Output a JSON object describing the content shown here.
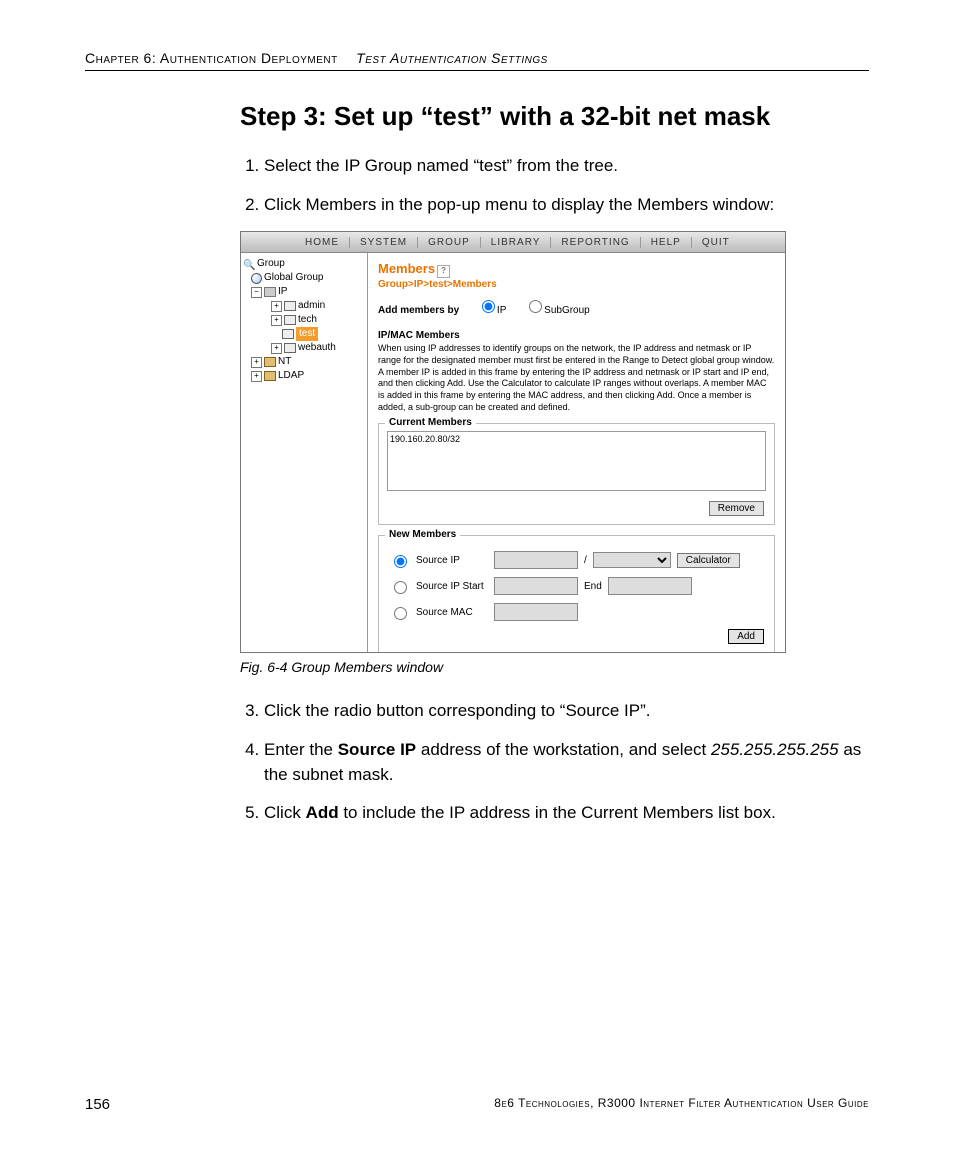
{
  "header": {
    "chapter": "Chapter 6: Authentication Deployment",
    "section": "Test Authentication Settings"
  },
  "title": "Step 3: Set up “test” with a 32-bit net mask",
  "list1": {
    "i1": "Select the IP Group named “test” from the tree.",
    "i2": "Click Members in the pop-up menu to display the Members window:"
  },
  "figure": {
    "caption": "Fig. 6-4  Group Members window",
    "menubar": {
      "home": "HOME",
      "system": "SYSTEM",
      "group": "GROUP",
      "library": "LIBRARY",
      "reporting": "REPORTING",
      "help": "HELP",
      "quit": "QUIT"
    },
    "tree": {
      "root": "Group",
      "global": "Global Group",
      "ip": "IP",
      "items": {
        "admin": "admin",
        "tech": "tech",
        "test": "test",
        "webauth": "webauth"
      },
      "nt": "NT",
      "ldap": "LDAP"
    },
    "detail": {
      "title": "Members",
      "breadcrumb": "Group>IP>test>Members",
      "addby_label": "Add members by",
      "radio_ip": "IP",
      "radio_sub": "SubGroup",
      "ipmac_title": "IP/MAC Members",
      "help": "When using IP addresses to identify groups on the network, the IP address and netmask or IP range for the designated member must first be entered in the Range to Detect global group window. A member IP is added in this frame by entering the IP address and netmask or IP start and IP end, and then clicking Add. Use the Calculator to calculate IP ranges without overlaps. A member MAC is added in this frame by entering the MAC address, and then clicking Add. Once a member is added, a sub-group can be created and defined.",
      "current_legend": "Current Members",
      "current_value": "190.160.20.80/32",
      "remove_btn": "Remove",
      "new_legend": "New Members",
      "src_ip": "Source IP",
      "src_ip_start": "Source IP Start",
      "end_lbl": "End",
      "src_mac": "Source MAC",
      "slash": "/",
      "calc_btn": "Calculator",
      "add_btn": "Add"
    }
  },
  "list2": {
    "i3": "Click the radio button corresponding to “Source IP”.",
    "i4a": "Enter the ",
    "i4b": "Source IP",
    "i4c": " address of the workstation, and select ",
    "i4d": "255.255.255.255",
    "i4e": " as the subnet mask.",
    "i5a": "Click ",
    "i5b": "Add",
    "i5c": " to include the IP address in the Current Members list box."
  },
  "footer": {
    "page": "156",
    "book": "8e6 Technologies, R3000 Internet Filter Authentication User Guide"
  }
}
